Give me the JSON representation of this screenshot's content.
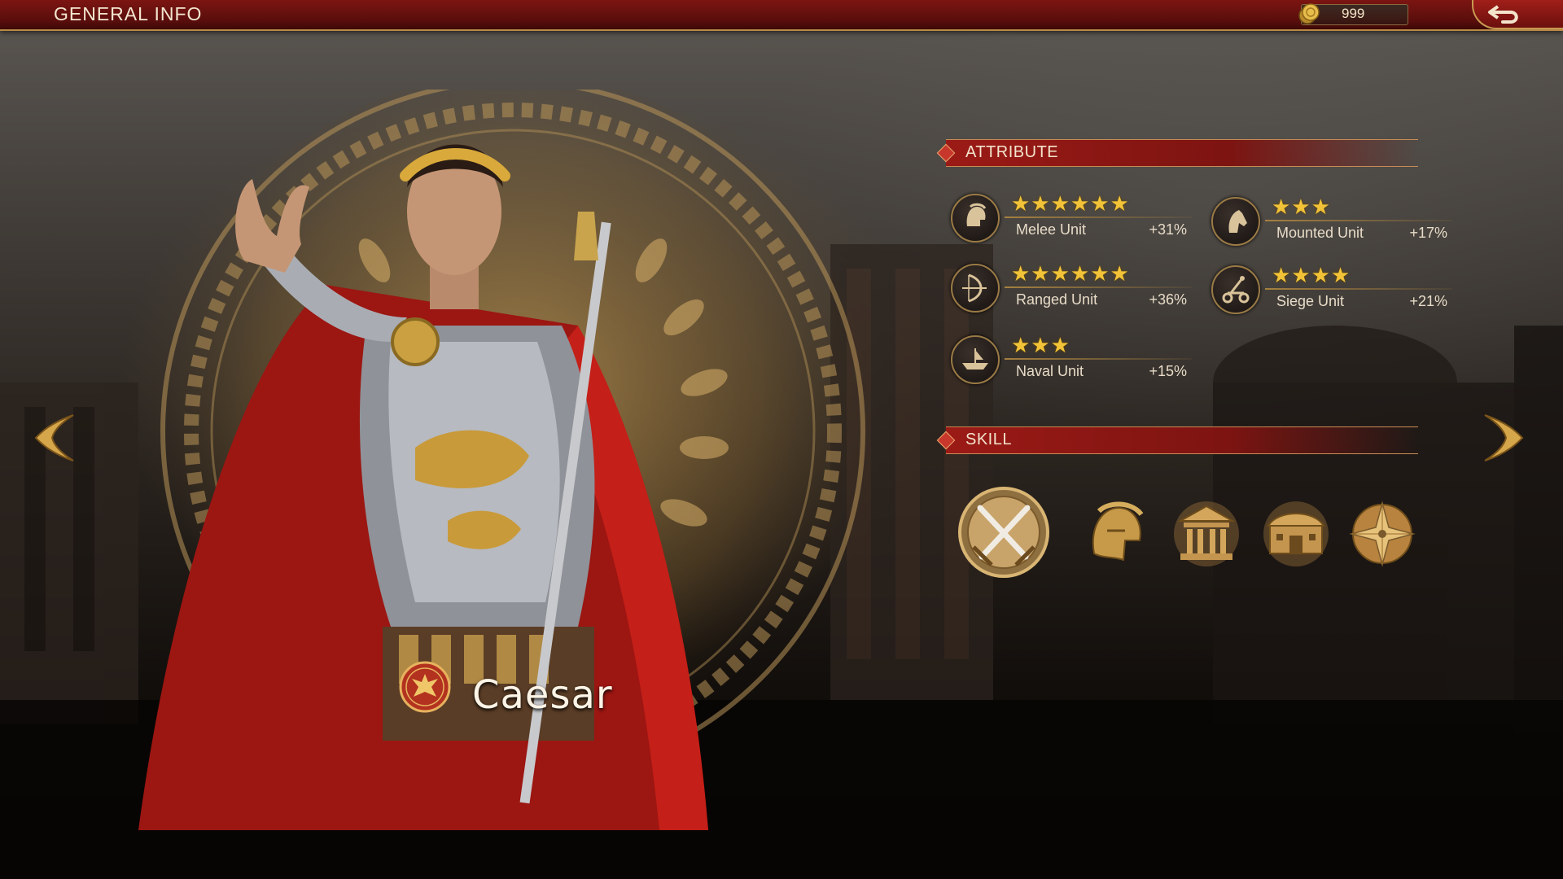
{
  "topbar": {
    "title": "GENERAL INFO",
    "currency_value": "999",
    "currency_icon": "gold-coin-icon",
    "back_icon": "return-arrow-icon"
  },
  "hero": {
    "name": "Caesar",
    "faction_icon": "roman-eagle-emblem-icon"
  },
  "navigation": {
    "prev_icon": "chevron-left-icon",
    "next_icon": "chevron-right-icon"
  },
  "attribute": {
    "title": "ATTRIBUTE",
    "items": [
      {
        "label": "Melee Unit",
        "bonus": "+31%",
        "stars": 6,
        "icon": "spartan-helmet-icon"
      },
      {
        "label": "Mounted Unit",
        "bonus": "+17%",
        "stars": 3,
        "icon": "horse-head-icon"
      },
      {
        "label": "Ranged Unit",
        "bonus": "+36%",
        "stars": 6,
        "icon": "bow-icon"
      },
      {
        "label": "Siege Unit",
        "bonus": "+21%",
        "stars": 4,
        "icon": "catapult-icon"
      },
      {
        "label": "Naval Unit",
        "bonus": "+15%",
        "stars": 3,
        "icon": "galley-ship-icon"
      }
    ]
  },
  "skill": {
    "title": "SKILL",
    "items": [
      {
        "icon": "crossed-swords-icon"
      },
      {
        "icon": "helmet-icon"
      },
      {
        "icon": "temple-icon"
      },
      {
        "icon": "treasury-building-icon"
      },
      {
        "icon": "compass-star-icon"
      }
    ]
  },
  "colors": {
    "topbar_red": "#7b1512",
    "gold": "#c9a35a",
    "star": "#f2c338",
    "header_red": "#9b1a16"
  }
}
